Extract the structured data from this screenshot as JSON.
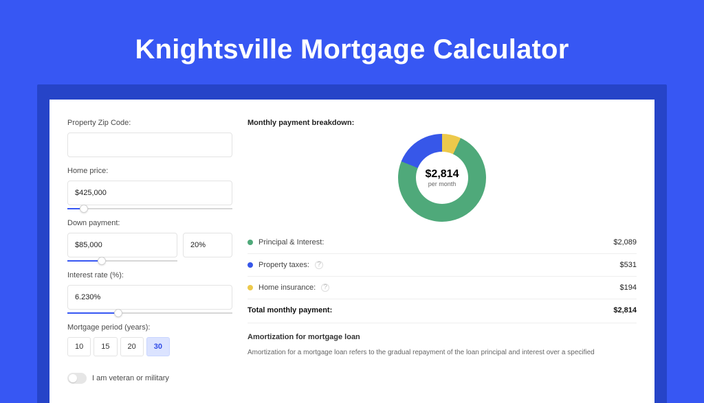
{
  "page": {
    "title": "Knightsville Mortgage Calculator"
  },
  "form": {
    "zip_label": "Property Zip Code:",
    "zip_value": "",
    "home_price_label": "Home price:",
    "home_price_value": "$425,000",
    "home_price_slider_pct": 10,
    "down_payment_label": "Down payment:",
    "down_payment_value": "$85,000",
    "down_payment_pct": "20%",
    "down_payment_slider_pct": 20,
    "interest_label": "Interest rate (%):",
    "interest_value": "6.230%",
    "interest_slider_pct": 31,
    "period_label": "Mortgage period (years):",
    "period_options": [
      "10",
      "15",
      "20",
      "30"
    ],
    "period_selected": "30",
    "veteran_label": "I am veteran or military",
    "veteran_on": false
  },
  "breakdown": {
    "title": "Monthly payment breakdown:",
    "donut_total": "$2,814",
    "donut_sub": "per month",
    "items": [
      {
        "name": "Principal & Interest:",
        "value": "$2,089",
        "color": "green"
      },
      {
        "name": "Property taxes:",
        "value": "$531",
        "color": "blue",
        "info": true
      },
      {
        "name": "Home insurance:",
        "value": "$194",
        "color": "yellow",
        "info": true
      }
    ],
    "total_label": "Total monthly payment:",
    "total_value": "$2,814",
    "amort_title": "Amortization for mortgage loan",
    "amort_text": "Amortization for a mortgage loan refers to the gradual repayment of the loan principal and interest over a specified"
  },
  "chart_data": {
    "type": "pie",
    "title": "Monthly payment breakdown",
    "total": 2814,
    "unit": "USD per month",
    "series": [
      {
        "name": "Principal & Interest",
        "value": 2089,
        "color": "#4fa97a"
      },
      {
        "name": "Property taxes",
        "value": 531,
        "color": "#3757e9"
      },
      {
        "name": "Home insurance",
        "value": 194,
        "color": "#edc94b"
      }
    ]
  }
}
